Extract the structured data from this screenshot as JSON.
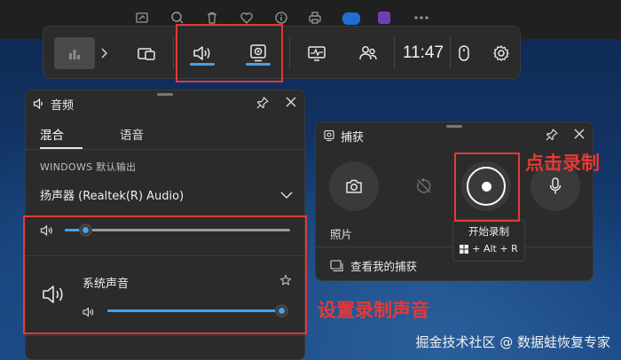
{
  "clock": "11:47",
  "audio": {
    "title": "音频",
    "tabs": [
      "混合",
      "语音"
    ],
    "output_label": "WINDOWS 默认输出",
    "device": "扬声器 (Realtek(R) Audio)",
    "master_volume": 0.09,
    "app_name": "系统声音",
    "app_volume": 1.0
  },
  "capture": {
    "title": "捕获",
    "photos_label": "照片",
    "gallery_link": "查看我的捕获",
    "record_tooltip": "开始录制",
    "record_shortcut": "+ Alt + R"
  },
  "annotations": {
    "click_record": "点击录制",
    "set_sound": "设置录制声音"
  },
  "watermark": "掘金技术社区 @ 数据蛙恢复专家",
  "colors": {
    "accent": "#4aa0e6",
    "highlight": "#e53935",
    "panel": "#2b2b2b"
  },
  "icons": [
    "image-edit-icon",
    "search-icon",
    "trash-icon",
    "heart-icon",
    "info-icon",
    "print-icon",
    "cloud-icon",
    "app-icon",
    "more-icon",
    "widget-icon",
    "chevron-right-icon",
    "window-icon",
    "speaker-icon",
    "capture-icon",
    "performance-icon",
    "people-icon",
    "mouse-icon",
    "settings-icon",
    "pin-icon",
    "close-icon",
    "chevron-down-icon",
    "star-icon",
    "camera-icon",
    "replay-off-icon",
    "record-icon",
    "microphone-icon",
    "gallery-icon",
    "windows-logo-icon"
  ]
}
